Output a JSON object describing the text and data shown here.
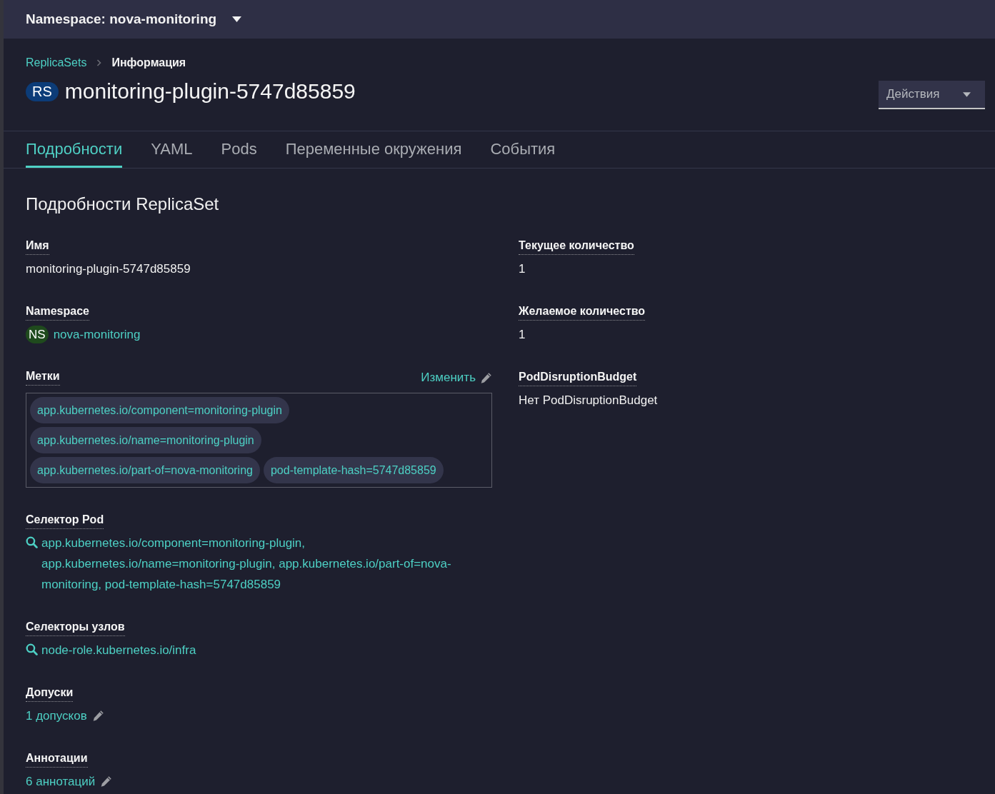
{
  "namespace_bar": {
    "label": "Namespace: nova-monitoring"
  },
  "breadcrumb": [
    {
      "kind": "link",
      "label": "ReplicaSets"
    },
    {
      "kind": "current",
      "label": "Информация"
    }
  ],
  "header": {
    "badge": "RS",
    "title": "monitoring-plugin-5747d85859",
    "actions_button": "Действия"
  },
  "tabs": [
    {
      "label": "Подробности",
      "selected": true
    },
    {
      "label": "YAML",
      "selected": false
    },
    {
      "label": "Pods",
      "selected": false
    },
    {
      "label": "Переменные окружения",
      "selected": false
    },
    {
      "label": "События",
      "selected": false
    }
  ],
  "details": {
    "heading": "Подробности ReplicaSet",
    "left": [
      {
        "kind": "text",
        "label": "Имя",
        "value": "monitoring-plugin-5747d85859"
      },
      {
        "kind": "resource_link",
        "label": "Namespace",
        "badge": "NS",
        "value": "nova-monitoring"
      },
      {
        "kind": "labels",
        "label": "Метки",
        "edit_label": "Изменить",
        "chips": [
          "app.kubernetes.io/component=monitoring-plugin",
          "app.kubernetes.io/name=monitoring-plugin",
          "app.kubernetes.io/part-of=nova-monitoring",
          "pod-template-hash=5747d85859"
        ]
      },
      {
        "kind": "search_link",
        "label": "Селектор Pod",
        "value": "app.kubernetes.io/component=monitoring-plugin, app.kubernetes.io/name=monitoring-plugin, app.kubernetes.io/part-of=nova-monitoring, pod-template-hash=5747d85859"
      },
      {
        "kind": "search_link",
        "label": "Селекторы узлов",
        "value": "node-role.kubernetes.io/infra"
      },
      {
        "kind": "edit_link",
        "label": "Допуски",
        "value": "1 допусков"
      },
      {
        "kind": "edit_link",
        "label": "Аннотации",
        "value": "6 аннотаций"
      }
    ],
    "right": [
      {
        "kind": "text",
        "label": "Текущее количество",
        "value": "1"
      },
      {
        "kind": "text",
        "label": "Желаемое количество",
        "value": "1"
      },
      {
        "kind": "text",
        "label": "PodDisruptionBudget",
        "value": "Нет PodDisruptionBudget"
      }
    ]
  }
}
